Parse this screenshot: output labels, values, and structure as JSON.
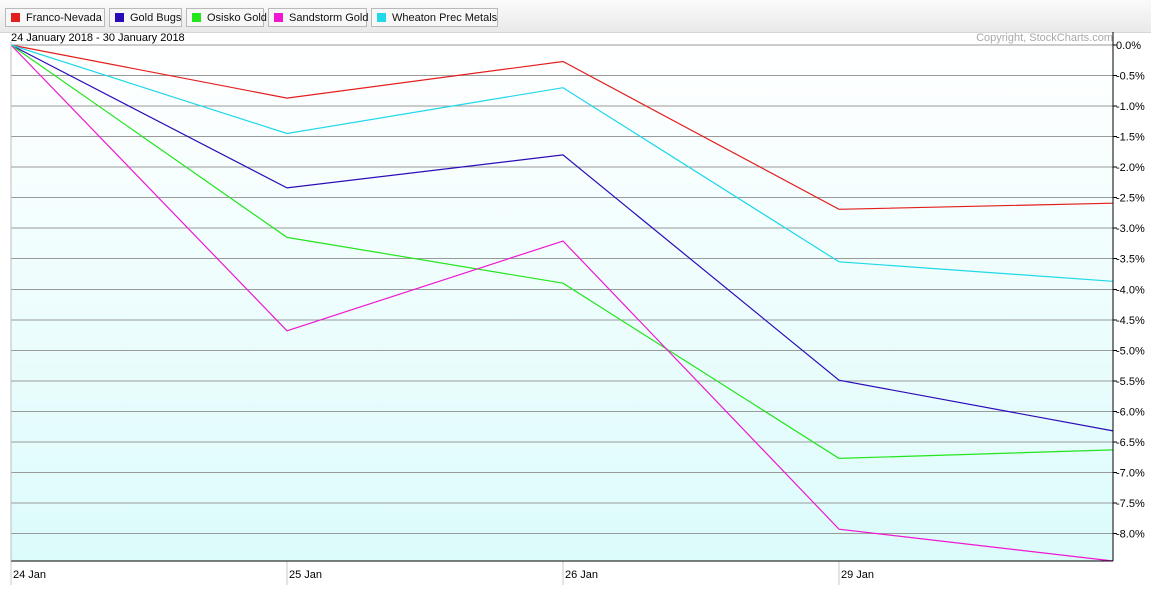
{
  "legend": [
    {
      "label": "Franco-Nevada",
      "color": "#e31e1e"
    },
    {
      "label": "Gold Bugs",
      "color": "#2b0bb8"
    },
    {
      "label": "Osisko Gold",
      "color": "#22e51c"
    },
    {
      "label": "Sandstorm Gold",
      "color": "#ef17d2"
    },
    {
      "label": "Wheaton Prec Metals",
      "color": "#1fd8e8"
    }
  ],
  "header": {
    "range": "24 January 2018 - 30 January 2018",
    "copyright": "Copyright, StockCharts.com"
  },
  "chart_data": {
    "type": "line",
    "x": [
      "24 Jan",
      "25 Jan",
      "26 Jan",
      "29 Jan",
      "30 Jan"
    ],
    "x_tick_labels": [
      "24  Jan",
      "25  Jan",
      "26  Jan",
      "29  Jan"
    ],
    "y_tick_labels": [
      "0.0%",
      "-0.5%",
      "-1.0%",
      "-1.5%",
      "-2.0%",
      "-2.5%",
      "-3.0%",
      "-3.5%",
      "-4.0%",
      "-4.5%",
      "-5.0%",
      "-5.5%",
      "-6.0%",
      "-6.5%",
      "-7.0%",
      "-7.5%",
      "-8.0%"
    ],
    "y_ticks": [
      0,
      -0.5,
      -1.0,
      -1.5,
      -2.0,
      -2.5,
      -3.0,
      -3.5,
      -4.0,
      -4.5,
      -5.0,
      -5.5,
      -6.0,
      -6.5,
      -7.0,
      -7.5,
      -8.0
    ],
    "ylim": [
      -8.45,
      0
    ],
    "y_axis_side": "right",
    "grid": true,
    "legend_position": "top",
    "series": [
      {
        "name": "Franco-Nevada",
        "color": "#e31e1e",
        "values": [
          0,
          -0.87,
          -0.27,
          -2.69,
          -2.59
        ]
      },
      {
        "name": "Gold Bugs",
        "color": "#2b0bb8",
        "values": [
          0,
          -2.34,
          -1.8,
          -5.49,
          -6.32
        ]
      },
      {
        "name": "Osisko Gold",
        "color": "#22e51c",
        "values": [
          0,
          -3.15,
          -3.9,
          -6.77,
          -6.63
        ]
      },
      {
        "name": "Sandstorm Gold",
        "color": "#ef17d2",
        "values": [
          0,
          -4.68,
          -3.21,
          -7.93,
          -8.45
        ]
      },
      {
        "name": "Wheaton Prec Metals",
        "color": "#1fd8e8",
        "values": [
          0,
          -1.45,
          -0.7,
          -3.55,
          -3.87
        ]
      }
    ],
    "plot_background_top": "#ffffff",
    "plot_background_bottom": "#dcfbfb",
    "gridline_color": "#9a9a9a"
  }
}
